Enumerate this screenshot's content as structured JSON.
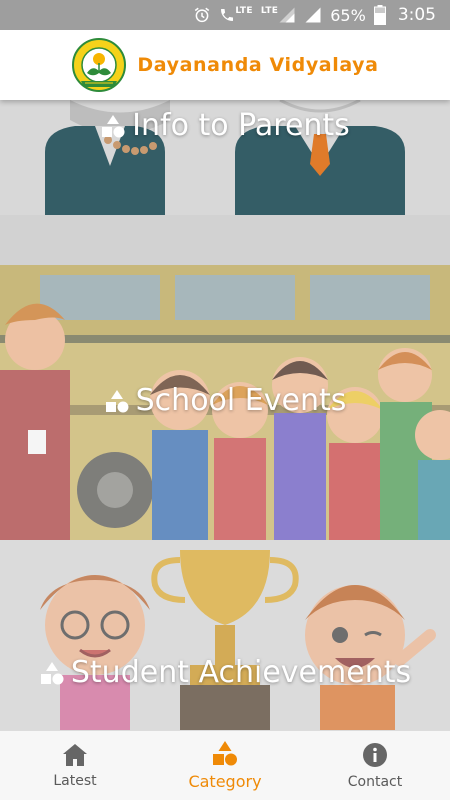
{
  "status_bar": {
    "network_label": "LTE",
    "call_lte_label": "LTE",
    "battery_percent": "65%",
    "time": "3:05"
  },
  "app_bar": {
    "title": "Dayananda Vidyalaya"
  },
  "categories": [
    {
      "label": "Info to Parents"
    },
    {
      "label": "School Events"
    },
    {
      "label": "Student Achievements"
    }
  ],
  "bottom_nav": {
    "items": [
      {
        "label": "Latest",
        "icon": "home-icon"
      },
      {
        "label": "Category",
        "icon": "category-icon"
      },
      {
        "label": "Contact",
        "icon": "info-icon"
      }
    ],
    "active_index": 1
  },
  "colors": {
    "accent": "#ef8a07",
    "status_bar": "#9e9e9e",
    "nav_inactive": "#5a5a5a"
  }
}
